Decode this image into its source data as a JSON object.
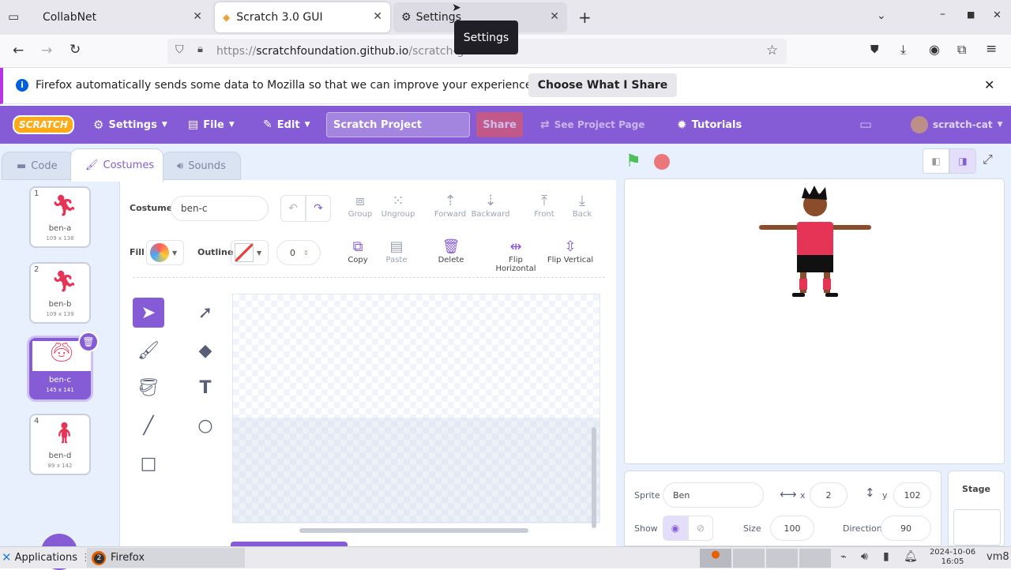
{
  "browser": {
    "tabs": [
      {
        "label": "CollabNet"
      },
      {
        "label": "Scratch 3.0 GUI"
      },
      {
        "label": "Settings"
      }
    ],
    "tooltip": "Settings",
    "url_prefix": "https://",
    "url_host": "scratchfoundation.github.io",
    "url_path": "/scratch-g",
    "infobar_text": "Firefox automatically sends some data to Mozilla so that we can improve your experience.",
    "infobar_button": "Choose What I Share"
  },
  "menubar": {
    "logo": "SCRATCH",
    "settings": "Settings",
    "file": "File",
    "edit": "Edit",
    "project_title": "Scratch Project",
    "share": "Share",
    "see_project": "See Project Page",
    "tutorials": "Tutorials",
    "user": "scratch-cat"
  },
  "editor_tabs": {
    "code": "Code",
    "costumes": "Costumes",
    "sounds": "Sounds"
  },
  "costumes": [
    {
      "num": "1",
      "name": "ben-a",
      "size": "109 x 138"
    },
    {
      "num": "2",
      "name": "ben-b",
      "size": "109 x 139"
    },
    {
      "num": "3",
      "name": "ben-c",
      "size": "145 x 141"
    },
    {
      "num": "4",
      "name": "ben-d",
      "size": "89 x 142"
    }
  ],
  "paint": {
    "costume_label": "Costume",
    "costume_name": "ben-c",
    "group": "Group",
    "ungroup": "Ungroup",
    "forward": "Forward",
    "backward": "Backward",
    "front": "Front",
    "back": "Back",
    "fill": "Fill",
    "outline": "Outline",
    "outline_width": "0",
    "copy": "Copy",
    "paste": "Paste",
    "delete": "Delete",
    "flip_h": "Flip Horizontal",
    "flip_v": "Flip Vertical"
  },
  "sprite_info": {
    "sprite_label": "Sprite",
    "sprite_name": "Ben",
    "x_label": "x",
    "x": "2",
    "y_label": "y",
    "y": "102",
    "show_label": "Show",
    "size_label": "Size",
    "size": "100",
    "direction_label": "Direction",
    "direction": "90",
    "stage_label": "Stage"
  },
  "taskbar": {
    "applications": "Applications",
    "firefox": "Firefox",
    "firefox_count": "2",
    "date": "2024-10-06",
    "time": "16:05",
    "host": "vm8"
  },
  "colors": {
    "scratch_purple": "#855cd6",
    "share_red": "#e95a5a",
    "green_flag": "#4cbf56",
    "stop": "#ec5959"
  }
}
